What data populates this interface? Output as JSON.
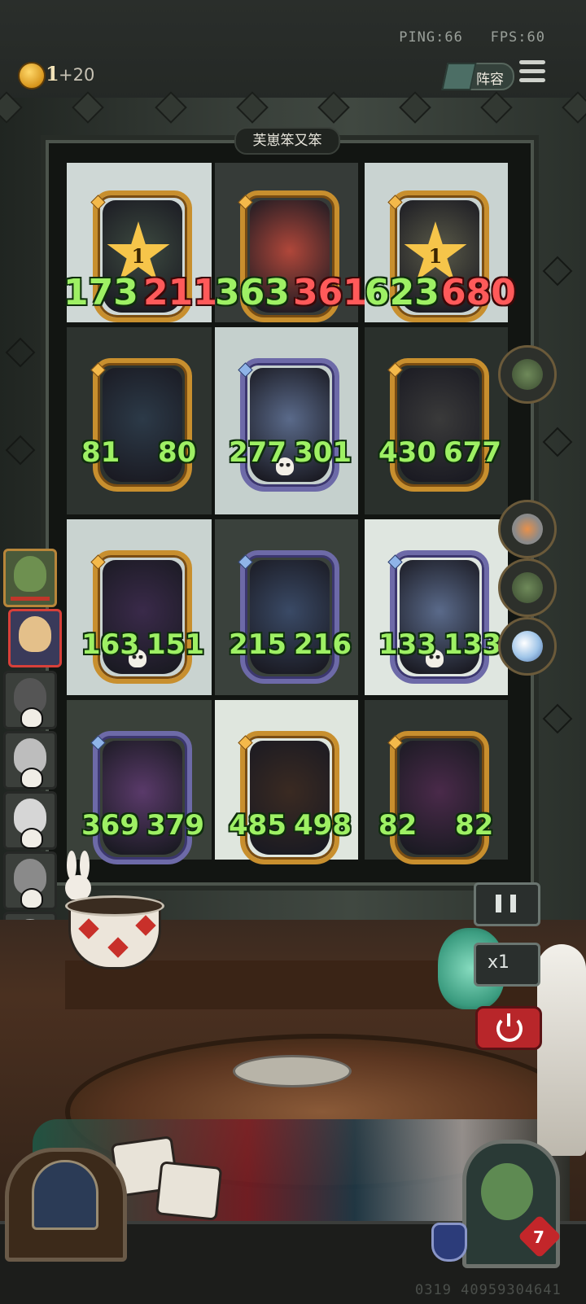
{
  "hud": {
    "ping_label": "PING:66",
    "fps_label": "FPS:60",
    "coins": "1",
    "coins_bonus": "+20",
    "lineup_label": "阵容"
  },
  "board": {
    "title": "芙崽笨又笨",
    "cells": [
      {
        "atk": "173",
        "hp": "211",
        "star": "1",
        "frame": "gold"
      },
      {
        "atk": "363",
        "hp": "361",
        "frame": "gold"
      },
      {
        "atk": "623",
        "hp": "680",
        "star": "1",
        "frame": "gold"
      },
      {
        "atk": "81",
        "hp": "80",
        "frame": "gold"
      },
      {
        "atk": "277",
        "hp": "301",
        "frame": "purple"
      },
      {
        "atk": "430",
        "hp": "677",
        "frame": "gold"
      },
      {
        "atk": "163",
        "hp": "151",
        "frame": "gold"
      },
      {
        "atk": "215",
        "hp": "216",
        "frame": "purple"
      },
      {
        "atk": "133",
        "hp": "133",
        "frame": "purple"
      },
      {
        "atk": "369",
        "hp": "379",
        "frame": "purple"
      },
      {
        "atk": "485",
        "hp": "498",
        "frame": "gold"
      },
      {
        "atk": "82",
        "hp": "82",
        "frame": "gold"
      }
    ]
  },
  "controls": {
    "speed_label": "x1"
  },
  "player": {
    "lives": "7"
  },
  "seed": "0319 40959304641",
  "colors": {
    "stat_green": "#9ef064",
    "stat_red": "#ff5a5a",
    "gold_frame": "#c88f2e",
    "purple_frame": "#6d6aa8",
    "power_red": "#b8262a"
  }
}
